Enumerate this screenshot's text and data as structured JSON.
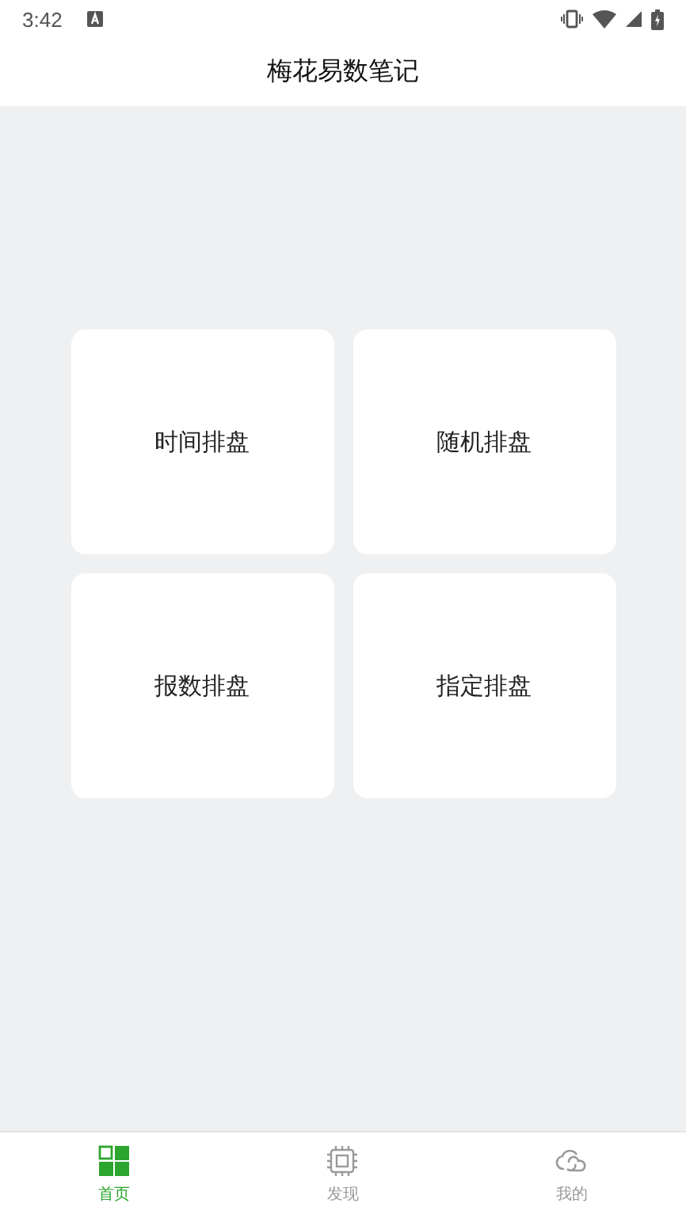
{
  "status_bar": {
    "time": "3:42"
  },
  "header": {
    "title": "梅花易数笔记"
  },
  "cards": [
    {
      "label": "时间排盘"
    },
    {
      "label": "随机排盘"
    },
    {
      "label": "报数排盘"
    },
    {
      "label": "指定排盘"
    }
  ],
  "tab_bar": [
    {
      "label": "首页",
      "kind": "home",
      "selected": true
    },
    {
      "label": "发现",
      "kind": "discover",
      "selected": false
    },
    {
      "label": "我的",
      "kind": "mine",
      "selected": false
    }
  ]
}
